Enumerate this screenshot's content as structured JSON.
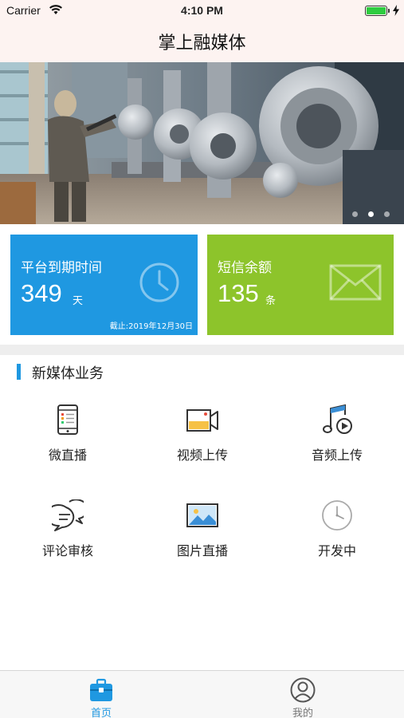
{
  "status_bar": {
    "carrier": "Carrier",
    "time": "4:10 PM",
    "battery_level": 1.0
  },
  "nav": {
    "title": "掌上融媒体"
  },
  "banner": {
    "page_count": 3,
    "active_page": 2
  },
  "stats": [
    {
      "label": "平台到期时间",
      "value": "349",
      "unit": "天",
      "note": "截止:2019年12月30日",
      "icon": "clock-icon",
      "color": "#1f98e1"
    },
    {
      "label": "短信余额",
      "value": "135",
      "unit": "条",
      "icon": "envelope-icon",
      "color": "#8dc42b"
    }
  ],
  "section": {
    "title": "新媒体业务",
    "accent": "#1f98e1"
  },
  "services": [
    {
      "label": "微直播",
      "icon": "phone-icon"
    },
    {
      "label": "视频上传",
      "icon": "video-camera-icon"
    },
    {
      "label": "音频上传",
      "icon": "music-note-icon"
    },
    {
      "label": "评论审核",
      "icon": "chat-bubbles-icon"
    },
    {
      "label": "图片直播",
      "icon": "picture-icon"
    },
    {
      "label": "开发中",
      "icon": "clock-icon"
    }
  ],
  "tabs": [
    {
      "label": "首页",
      "icon": "briefcase-icon",
      "active": true
    },
    {
      "label": "我的",
      "icon": "user-icon",
      "active": false
    }
  ]
}
